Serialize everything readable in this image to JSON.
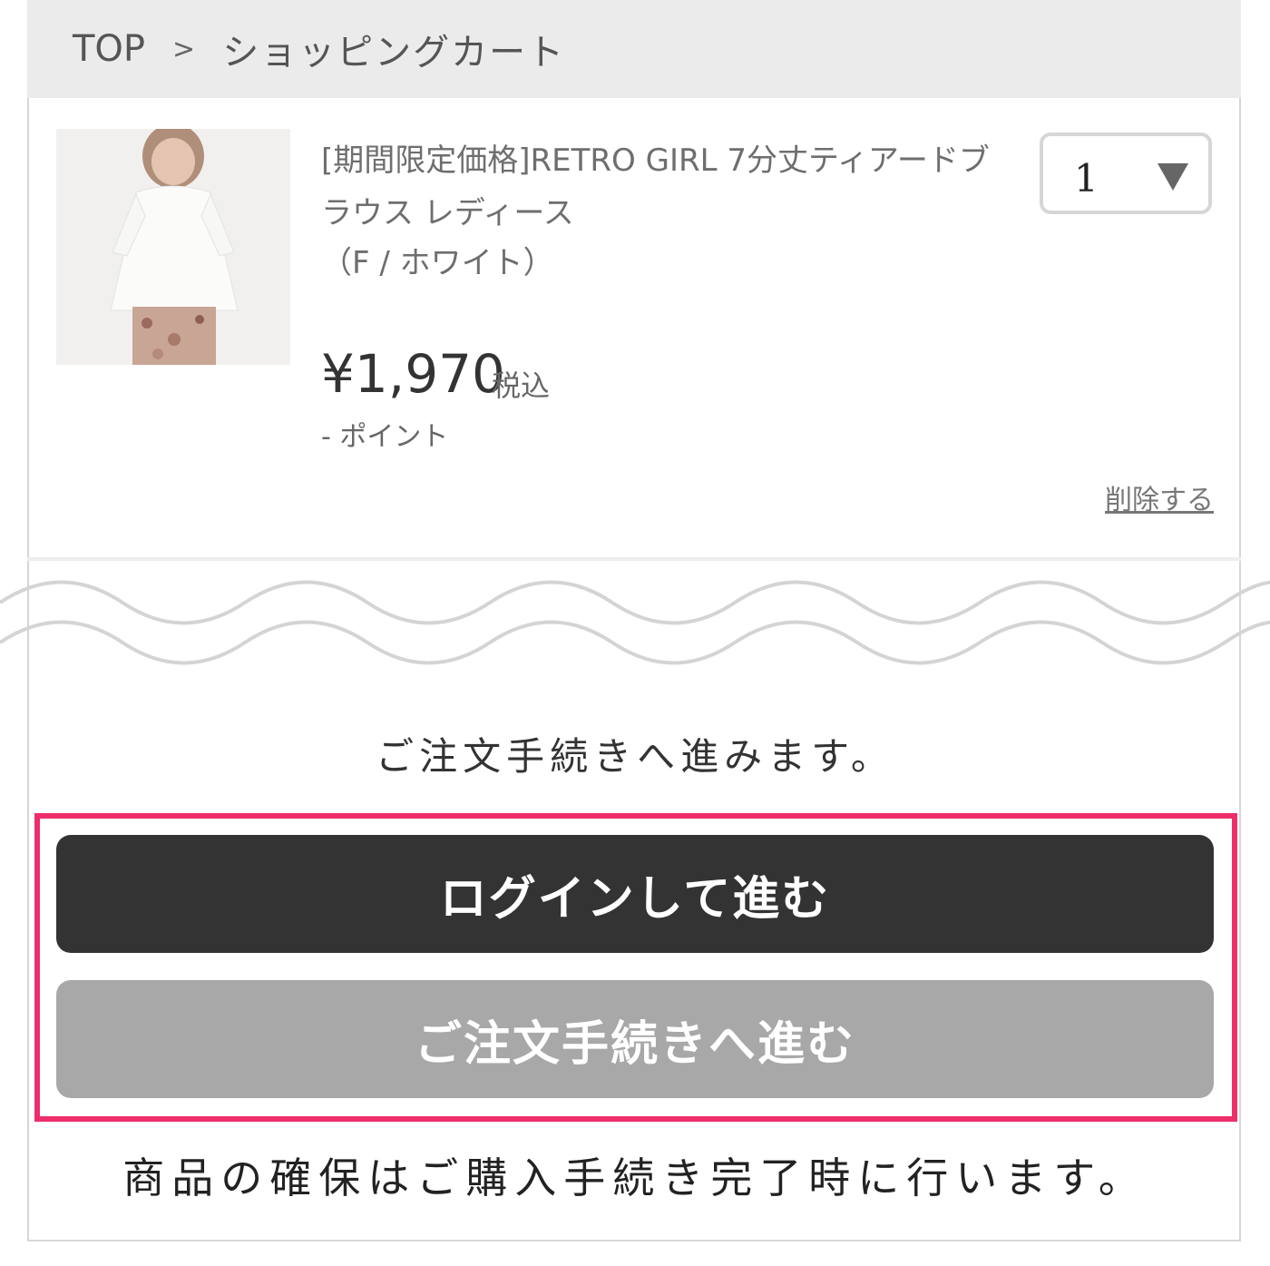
{
  "breadcrumb": {
    "home": "TOP",
    "separator": ">",
    "current": "ショッピングカート"
  },
  "cart_item": {
    "title": "[期間限定価格]RETRO GIRL 7分丈ティアードブラウス レディース",
    "variant": "（F / ホワイト）",
    "quantity": "1",
    "price": "¥1,970",
    "tax_label": "税込",
    "points": "- ポイント",
    "delete_label": "削除する"
  },
  "checkout": {
    "notice": "ご注文手続きへ進みます。",
    "login_button": "ログインして進む",
    "guest_button": "ご注文手続きへ進む",
    "footnote": "商品の確保はご購入手続き完了時に行います。"
  },
  "colors": {
    "highlight": "#ee2d6b",
    "login_button": "#333333",
    "guest_button": "#a8a8a8"
  }
}
